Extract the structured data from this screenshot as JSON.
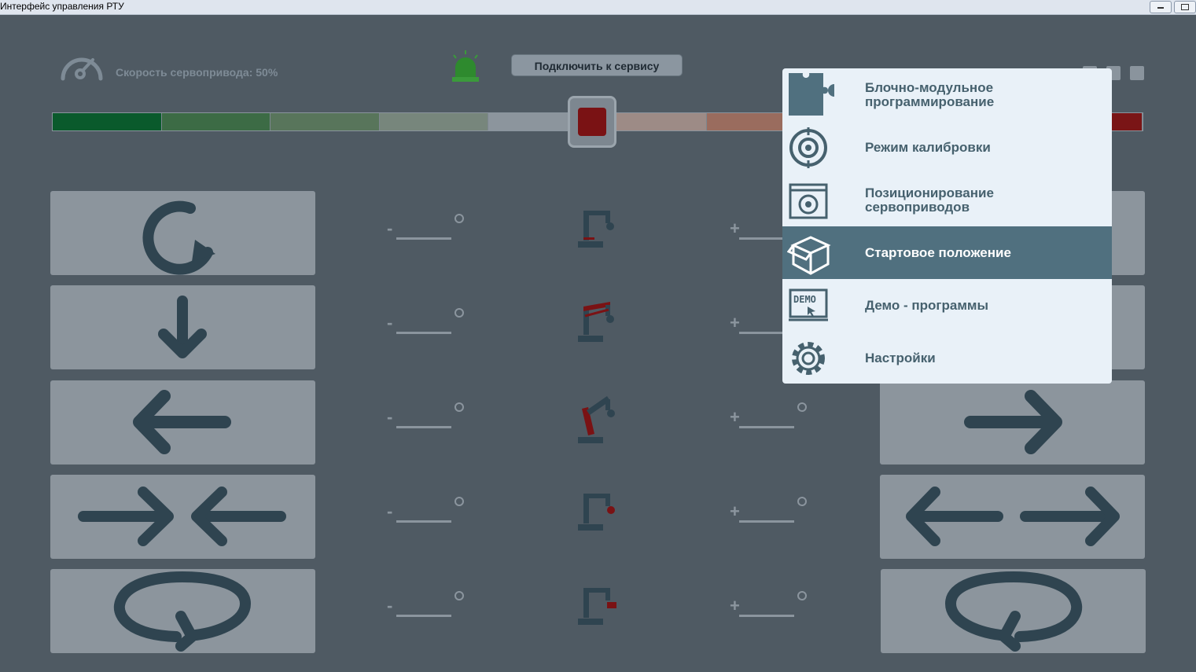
{
  "window": {
    "title": "Интерфейс управления РТУ"
  },
  "header": {
    "speed_label": "Скорость сервопривода: 50%",
    "connect_label": "Подключить к сервису"
  },
  "speed": {
    "value_percent": 50,
    "segments": [
      "#0a5a2c",
      "#3c6b45",
      "#58755b",
      "#77867c",
      "#8c959d",
      "#9d8b86",
      "#9a6c5e",
      "#8e4c40",
      "#7d2b24",
      "#7a1516"
    ]
  },
  "axes": [
    {
      "minus": "-",
      "plus": "+"
    },
    {
      "minus": "-",
      "plus": "+"
    },
    {
      "minus": "-",
      "plus": "+"
    },
    {
      "minus": "-",
      "plus": "+"
    },
    {
      "minus": "-",
      "plus": "+"
    }
  ],
  "menu": {
    "items": [
      {
        "label": "Блочно-модульное программирование",
        "icon": "puzzle-icon"
      },
      {
        "label": "Режим калибровки",
        "icon": "calibration-icon"
      },
      {
        "label": "Позиционирование сервоприводов",
        "icon": "servo-window-icon"
      },
      {
        "label": "Стартовое положение",
        "icon": "box-icon",
        "active": true
      },
      {
        "label": "Демо - программы",
        "icon": "demo-icon"
      },
      {
        "label": "Настройки",
        "icon": "gear-icon"
      }
    ]
  },
  "colors": {
    "accent_dark": "#2f4450",
    "menu_active": "#50707f",
    "menu_bg": "#e9f1f8",
    "stop_red": "#7a1214"
  }
}
